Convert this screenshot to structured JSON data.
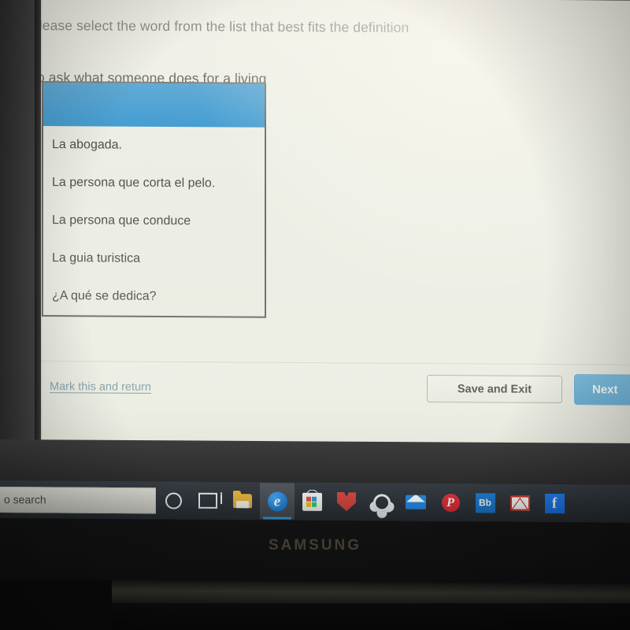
{
  "quiz": {
    "prompt_line1": "Please select the word from the list that best fits the definition",
    "prompt_line2": "to ask what someone does for a living",
    "listbox": {
      "selected_value": "",
      "options": [
        "La abogada.",
        "La persona que corta el pelo.",
        "La persona que conduce",
        "La guia turistica",
        "¿A qué se dedica?"
      ]
    },
    "footer": {
      "mark_link": "Mark this and return",
      "save_button": "Save and Exit",
      "next_button": "Next"
    }
  },
  "taskbar": {
    "search_text": "o search",
    "icons": [
      {
        "name": "cortana-icon",
        "label": "Cortana"
      },
      {
        "name": "task-view-icon",
        "label": "Task View"
      },
      {
        "name": "file-explorer-icon",
        "label": "File Explorer"
      },
      {
        "name": "edge-icon",
        "label": "e"
      },
      {
        "name": "microsoft-store-icon",
        "label": "Microsoft Store"
      },
      {
        "name": "mcafee-icon",
        "label": "McAfee"
      },
      {
        "name": "settings-gear-icon",
        "label": "S"
      },
      {
        "name": "mail-icon",
        "label": "Mail"
      },
      {
        "name": "pinterest-icon",
        "label": "P"
      },
      {
        "name": "blackboard-icon",
        "label": "Bb"
      },
      {
        "name": "gmail-icon",
        "label": "Gmail"
      },
      {
        "name": "facebook-icon",
        "label": "f"
      }
    ]
  },
  "device": {
    "brand": "SAMSUNG"
  },
  "colors": {
    "selection_blue": "#2f93d0",
    "next_button_blue": "#4aa3d6",
    "link_blue": "#6f8f9e",
    "page_background": "#eef0e7",
    "taskbar": "#2b3138"
  }
}
